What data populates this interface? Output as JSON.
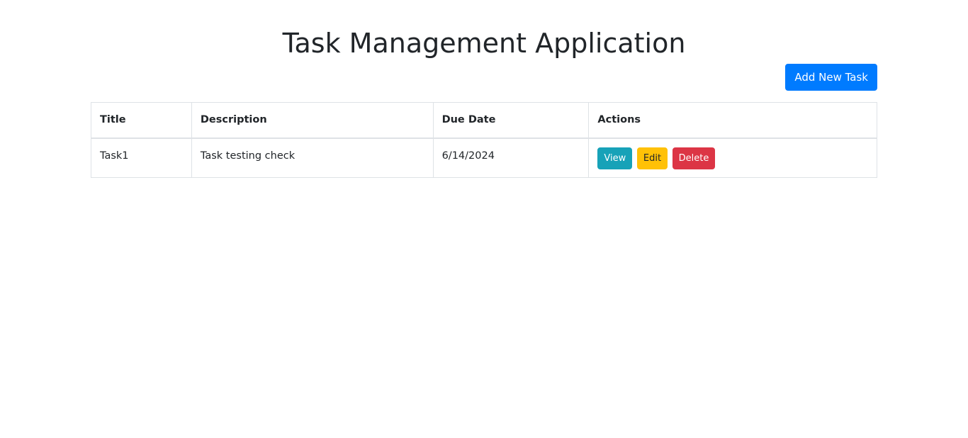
{
  "page": {
    "title": "Task Management Application"
  },
  "toolbar": {
    "add_label": "Add New Task"
  },
  "table": {
    "headers": [
      "Title",
      "Description",
      "Due Date",
      "Actions"
    ],
    "rows": [
      {
        "title": "Task1",
        "description": "Task testing check",
        "due_date": "6/14/2024",
        "actions": {
          "view_label": "View",
          "edit_label": "Edit",
          "delete_label": "Delete"
        }
      }
    ]
  },
  "colors": {
    "primary": "#007bff",
    "info": "#17a2b8",
    "warning": "#ffc107",
    "danger": "#dc3545",
    "border": "#dee2e6",
    "text": "#212529"
  }
}
